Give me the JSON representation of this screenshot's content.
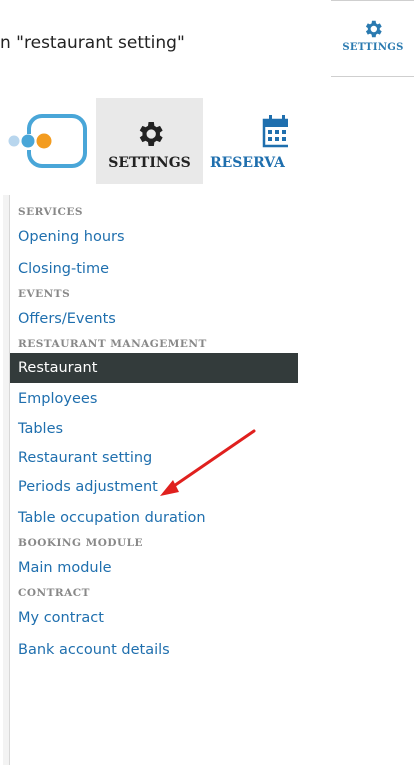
{
  "instruction_text": "n \"restaurant setting\"",
  "header": {
    "settings_label": "SETTINGS",
    "reservations_label": "RESERVA",
    "mini_settings_label": "SETTINGS"
  },
  "menu": {
    "services_header": "SERVICES",
    "opening_hours": "Opening hours",
    "closing_time": "Closing-time",
    "events_header": "EVENTS",
    "offers_events": "Offers/Events",
    "restaurant_management_header": "RESTAURANT MANAGEMENT",
    "restaurant": "Restaurant",
    "employees": "Employees",
    "tables": "Tables",
    "restaurant_setting": "Restaurant setting",
    "periods_adjustment": "Periods adjustment",
    "table_occupation_duration": "Table occupation duration",
    "booking_module_header": "BOOKING MODULE",
    "main_module": "Main module",
    "contract_header": "CONTRACT",
    "my_contract": "My contract",
    "bank_account_details": "Bank account details"
  },
  "colors": {
    "link": "#1f6fae",
    "active_bg": "#333b3b",
    "logo_orange": "#f39c20",
    "logo_blue": "#49a6d8",
    "arrow_red": "#e0201e"
  },
  "icons": {
    "logo": "app-logo",
    "settings": "gear-icon",
    "reservations": "calendar-icon",
    "annotation": "arrow-icon"
  }
}
